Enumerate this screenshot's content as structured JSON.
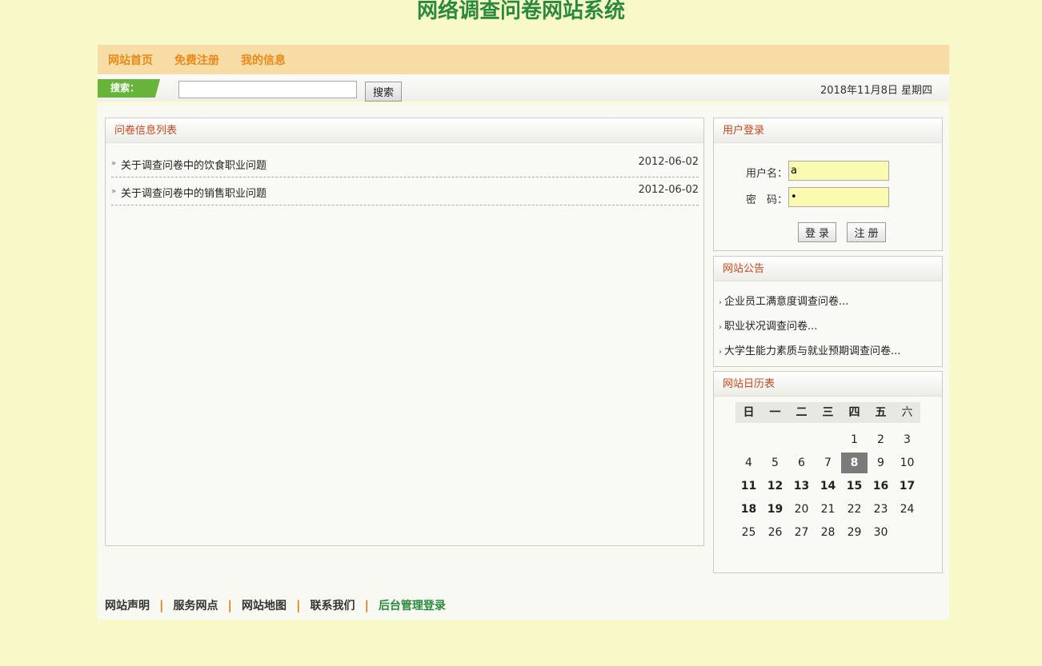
{
  "site_title": "网络调查问卷网站系统",
  "nav": {
    "home": "网站首页",
    "register": "免费注册",
    "my_info": "我的信息"
  },
  "search": {
    "label": "搜索：",
    "input_value": "",
    "button": "搜索"
  },
  "date_text": "2018年11月8日 星期四",
  "questionnaire_list": {
    "title": "问卷信息列表",
    "items": [
      {
        "title": "关于调查问卷中的饮食职业问题",
        "date": "2012-06-02"
      },
      {
        "title": "关于调查问卷中的销售职业问题",
        "date": "2012-06-02"
      }
    ]
  },
  "login": {
    "title": "用户登录",
    "username_label": "用户名：",
    "username_value": "a",
    "password_label": "密　码：",
    "password_value": "•",
    "login_button": "登录",
    "register_button": "注册"
  },
  "notice": {
    "title": "网站公告",
    "items": [
      "企业员工满意度调查问卷...",
      "职业状况调查问卷...",
      "大学生能力素质与就业预期调查问卷..."
    ]
  },
  "calendar": {
    "title": "网站日历表",
    "weekdays": [
      "日",
      "一",
      "二",
      "三",
      "四",
      "五",
      "六"
    ],
    "weeks": [
      [
        "",
        "",
        "",
        "",
        "1",
        "2",
        "3"
      ],
      [
        "4",
        "5",
        "6",
        "7",
        "8",
        "9",
        "10"
      ],
      [
        "11",
        "12",
        "13",
        "14",
        "15",
        "16",
        "17"
      ],
      [
        "18",
        "19",
        "20",
        "21",
        "22",
        "23",
        "24"
      ],
      [
        "25",
        "26",
        "27",
        "28",
        "29",
        "30",
        ""
      ]
    ],
    "today": "8"
  },
  "footer": {
    "statement": "网站声明",
    "service": "服务网点",
    "sitemap": "网站地图",
    "contact": "联系我们",
    "admin": "后台管理登录"
  }
}
